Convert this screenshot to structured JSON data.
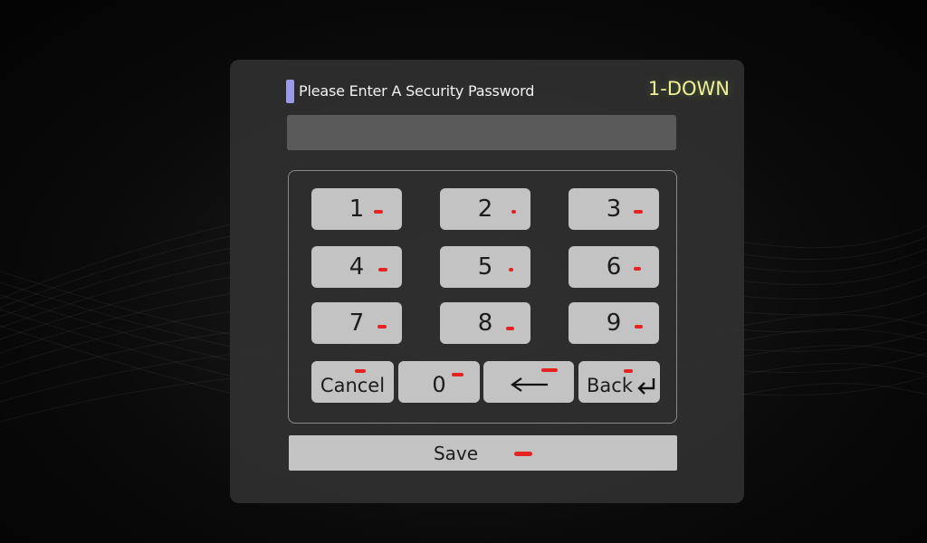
{
  "dialog": {
    "title": "Please Enter A Security  Password",
    "mode_label": "1-DOWN",
    "password_value": ""
  },
  "keypad": {
    "keys": {
      "k1": "1",
      "k2": "2",
      "k3": "3",
      "k4": "4",
      "k5": "5",
      "k6": "6",
      "k7": "7",
      "k8": "8",
      "k9": "9",
      "cancel": "Cancel",
      "k0": "0",
      "back": "Back"
    },
    "backspace_icon": "arrow-left-icon",
    "enter_icon": "return-arrow-icon"
  },
  "save_label": "Save",
  "colors": {
    "accent_marker": "#9a9ae6",
    "mode_label": "#f0f09a",
    "key_bg": "#c3c3c3",
    "indicator": "#e62222"
  }
}
